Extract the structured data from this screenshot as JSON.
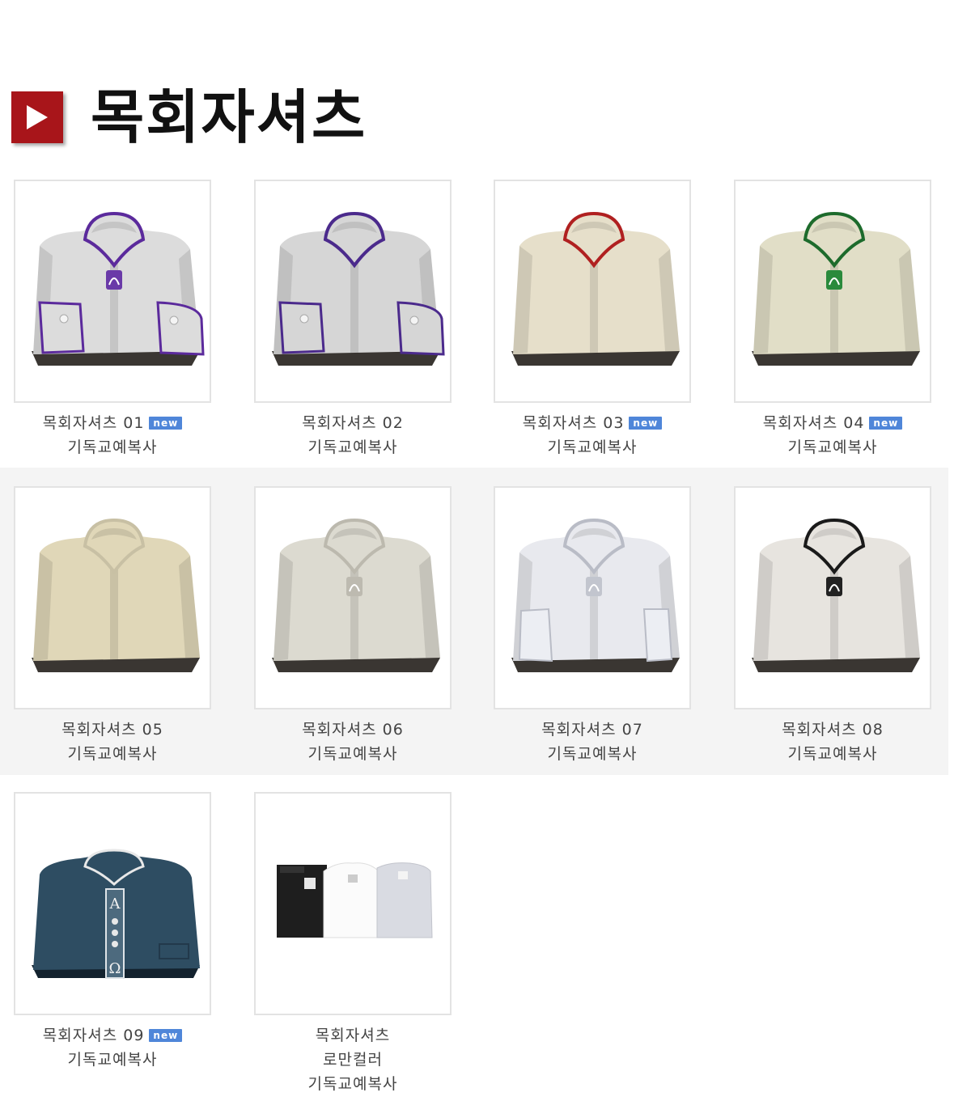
{
  "page": {
    "title": "목회자셔츠"
  },
  "colors": {
    "accent": "#a8151a",
    "badge": "#4f86d9",
    "band": "#f4f4f4"
  },
  "products": [
    {
      "name": "목회자셔츠 01",
      "badge": "new",
      "subtitle": "",
      "brand": "기독교예복사",
      "shirt_color": "#dcdcdc",
      "trim_color": "#5b2a9c",
      "image": "white shirt with purple trim"
    },
    {
      "name": "목회자셔츠 02",
      "badge": "",
      "subtitle": "",
      "brand": "기독교예복사",
      "shirt_color": "#d6d6d6",
      "trim_color": "#4b2a8c",
      "image": "white shirt with purple trim"
    },
    {
      "name": "목회자셔츠 03",
      "badge": "new",
      "subtitle": "",
      "brand": "기독교예복사",
      "shirt_color": "#e6dfca",
      "trim_color": "#b02020",
      "image": "ivory shirt with red trim"
    },
    {
      "name": "목회자셔츠 04",
      "badge": "new",
      "subtitle": "",
      "brand": "기독교예복사",
      "shirt_color": "#e1dec7",
      "trim_color": "#1d6b2c",
      "image": "ivory shirt with green trim"
    },
    {
      "name": "목회자셔츠 05",
      "badge": "",
      "subtitle": "",
      "brand": "기독교예복사",
      "shirt_color": "#e0d7b8",
      "trim_color": "#c8c0a4",
      "image": "beige shirt"
    },
    {
      "name": "목회자셔츠 06",
      "badge": "",
      "subtitle": "",
      "brand": "기독교예복사",
      "shirt_color": "#dcdad0",
      "trim_color": "#bcb9ae",
      "image": "light gray shirt"
    },
    {
      "name": "목회자셔츠 07",
      "badge": "",
      "subtitle": "",
      "brand": "기독교예복사",
      "shirt_color": "#e8e9ee",
      "trim_color": "#b9bcc6",
      "image": "white shirt with gray trim"
    },
    {
      "name": "목회자셔츠 08",
      "badge": "",
      "subtitle": "",
      "brand": "기독교예복사",
      "shirt_color": "#e7e4df",
      "trim_color": "#1a1a1a",
      "image": "off-white shirt with black trim"
    },
    {
      "name": "목회자셔츠 09",
      "badge": "new",
      "subtitle": "",
      "brand": "기독교예복사",
      "shirt_color": "#2e4d62",
      "trim_color": "#e8e8e8",
      "image": "navy shirt with alpha omega embroidery"
    },
    {
      "name": "목회자셔츠",
      "badge": "",
      "subtitle": "로만컬러",
      "brand": "기독교예복사",
      "shirt_color": "#ffffff",
      "trim_color": "#333333",
      "image": "three roman collar shirts black white gray"
    }
  ]
}
